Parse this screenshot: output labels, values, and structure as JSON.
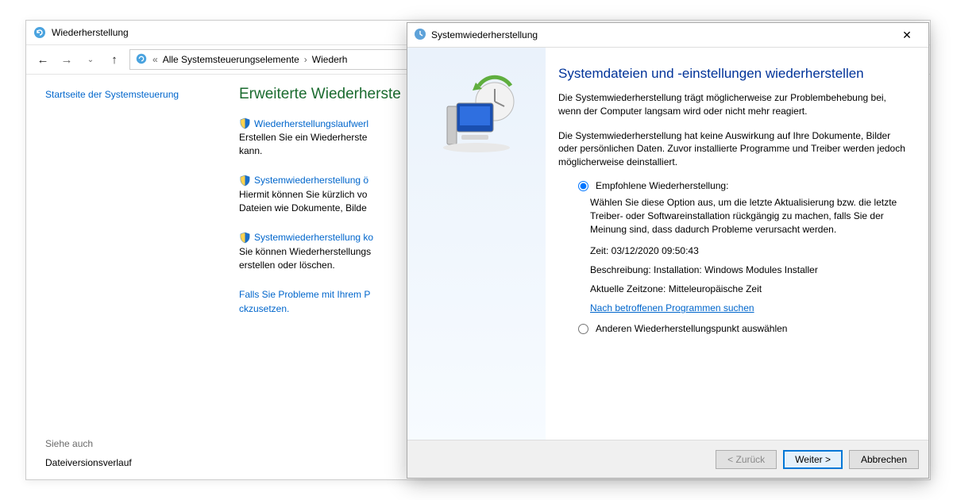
{
  "controlPanel": {
    "title": "Wiederherstellung",
    "breadcrumb": {
      "part1": "Alle Systemsteuerungselemente",
      "part2": "Wiederh"
    },
    "sidebar": {
      "home": "Startseite der Systemsteuerung",
      "seeAlso": "Siehe auch",
      "fileHistory": "Dateiversionsverlauf"
    },
    "main": {
      "heading": "Erweiterte Wiederherste",
      "task1": {
        "title": "Wiederherstellungslaufwerl",
        "desc": "Erstellen Sie ein Wiederherste\nkann."
      },
      "task2": {
        "title": "Systemwiederherstellung ö",
        "desc": "Hiermit können Sie kürzlich vo\nDateien wie Dokumente, Bilde"
      },
      "task3": {
        "title": "Systemwiederherstellung ko",
        "desc": "Sie können Wiederherstellungs\nerstellen oder löschen."
      },
      "note": "Falls Sie Probleme mit Ihrem P\nckzusetzen."
    }
  },
  "dialog": {
    "title": "Systemwiederherstellung",
    "heading": "Systemdateien und -einstellungen wiederherstellen",
    "para1": "Die Systemwiederherstellung trägt möglicherweise zur Problembehebung bei, wenn der Computer langsam wird oder nicht mehr reagiert.",
    "para2": "Die Systemwiederherstellung hat keine Auswirkung auf Ihre Dokumente, Bilder oder persönlichen Daten. Zuvor installierte Programme und Treiber werden jedoch möglicherweise deinstalliert.",
    "option1": {
      "label": "Empfohlene Wiederherstellung:",
      "desc": "Wählen Sie diese Option aus, um die letzte Aktualisierung bzw. die letzte Treiber- oder Softwareinstallation rückgängig zu machen, falls Sie der Meinung sind, dass dadurch Probleme verursacht werden.",
      "time": "Zeit: 03/12/2020 09:50:43",
      "descLine": "Beschreibung: Installation: Windows Modules Installer",
      "tz": "Aktuelle Zeitzone: Mitteleuropäische Zeit",
      "scan": "Nach betroffenen Programmen suchen"
    },
    "option2": {
      "label": "Anderen Wiederherstellungspunkt auswählen"
    },
    "buttons": {
      "back": "< Zurück",
      "next": "Weiter >",
      "cancel": "Abbrechen"
    }
  }
}
